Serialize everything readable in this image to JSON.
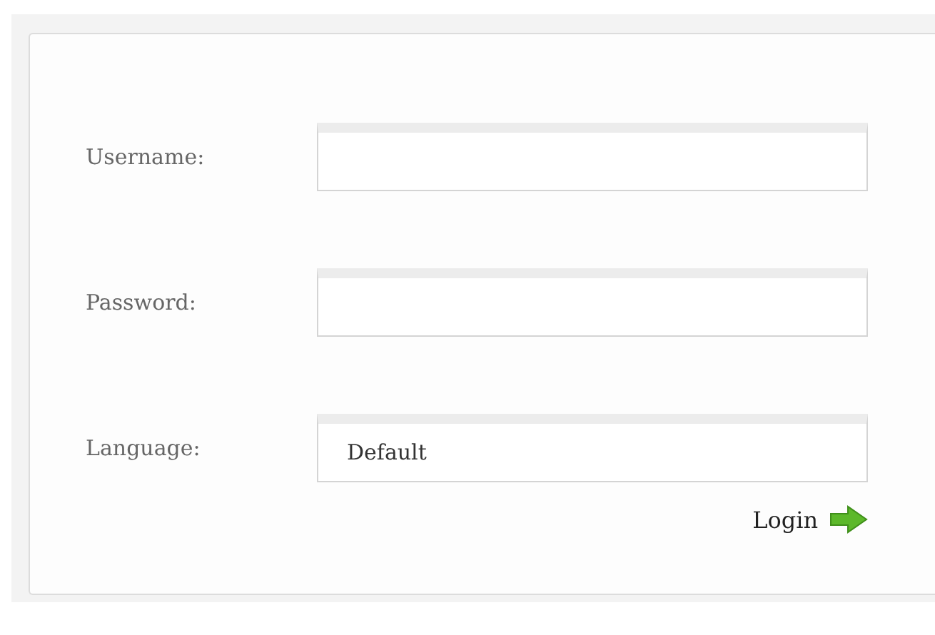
{
  "fields": [
    {
      "label": "Username:",
      "kind": "text"
    },
    {
      "label": "Password:",
      "kind": "password"
    },
    {
      "label": "Language:",
      "kind": "select",
      "value": "Default"
    }
  ],
  "login_button": {
    "label": "Login"
  }
}
